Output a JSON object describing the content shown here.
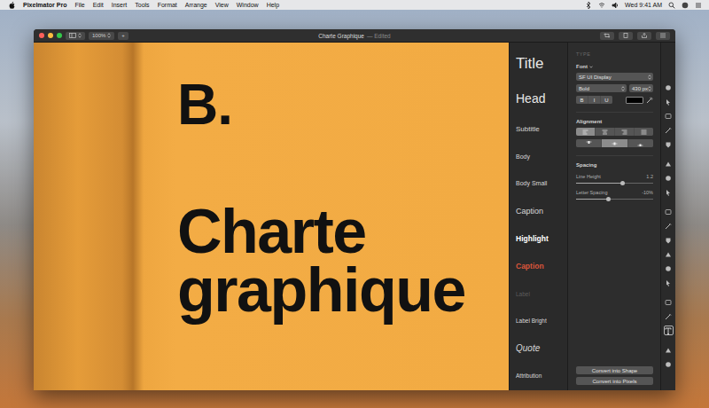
{
  "menu_bar": {
    "app": "Pixelmator Pro",
    "items": [
      "File",
      "Edit",
      "Insert",
      "Tools",
      "Format",
      "Arrange",
      "View",
      "Window",
      "Help"
    ],
    "clock": "Wed 9:41 AM"
  },
  "window": {
    "title": "Charte Graphique",
    "status": "— Edited",
    "zoom": "100%",
    "add": "+"
  },
  "canvas": {
    "letter": "B.",
    "heading_lines": [
      "Charte",
      "graphique"
    ]
  },
  "styles": [
    {
      "label": "Title",
      "kind": "title",
      "color": "#e8e8e8"
    },
    {
      "label": "Head",
      "kind": "head",
      "color": "#e8e8e8"
    },
    {
      "label": "Subtitle",
      "kind": "subtitle",
      "color": "#d8d8d8"
    },
    {
      "label": "Body",
      "kind": "body",
      "color": "#d8d8d8"
    },
    {
      "label": "Body Small",
      "kind": "body-small",
      "color": "#d8d8d8"
    },
    {
      "label": "Caption",
      "kind": "caption",
      "color": "#d8d8d8"
    },
    {
      "label": "Highlight",
      "kind": "highlight",
      "color": "#ffffff"
    },
    {
      "label": "Caption",
      "kind": "accent",
      "color": "#d9553a"
    },
    {
      "label": "Label",
      "kind": "label",
      "color": "#5c5c5c"
    },
    {
      "label": "Label Bright",
      "kind": "label-bright",
      "color": "#d8d8d8"
    },
    {
      "label": "Quote",
      "kind": "quote",
      "color": "#d8d8d8"
    },
    {
      "label": "Attribution",
      "kind": "attribution",
      "color": "#d8d8d8"
    }
  ],
  "inspector": {
    "section": "TYPE",
    "font_label": "Font",
    "font_family": "SF UI Display",
    "font_style": "Bold",
    "font_size": "430 px",
    "format_buttons": [
      {
        "label": "B",
        "selected": false
      },
      {
        "label": "I",
        "selected": false
      },
      {
        "label": "U",
        "selected": false
      }
    ],
    "text_color": "#000000",
    "alignment": {
      "label": "Alignment",
      "horizontal": [
        {
          "selected": true
        },
        {
          "selected": false
        },
        {
          "selected": false
        },
        {
          "selected": false
        }
      ],
      "vertical": [
        {
          "selected": false
        },
        {
          "selected": true
        },
        {
          "selected": false
        }
      ]
    },
    "spacing": {
      "label": "Spacing",
      "sliders": [
        {
          "name": "Line Height",
          "reading": "1.2",
          "level": 0.6
        },
        {
          "name": "Letter Spacing",
          "reading": "-10%",
          "level": 0.42
        }
      ]
    },
    "buttons": [
      "Convert into Shape",
      "Convert into Pixels"
    ]
  },
  "tools": [
    [
      {
        "selected": false
      },
      {
        "selected": false
      },
      {
        "selected": false
      },
      {
        "selected": false
      },
      {
        "selected": false
      }
    ],
    [
      {
        "selected": false
      },
      {
        "selected": false
      },
      {
        "selected": false
      }
    ],
    [
      {
        "selected": false
      },
      {
        "selected": false
      },
      {
        "selected": false
      },
      {
        "selected": false
      },
      {
        "selected": false
      },
      {
        "selected": false
      }
    ],
    [
      {
        "selected": false
      },
      {
        "selected": false
      },
      {
        "selected": true
      }
    ],
    [
      {
        "selected": false
      },
      {
        "selected": false
      }
    ]
  ]
}
